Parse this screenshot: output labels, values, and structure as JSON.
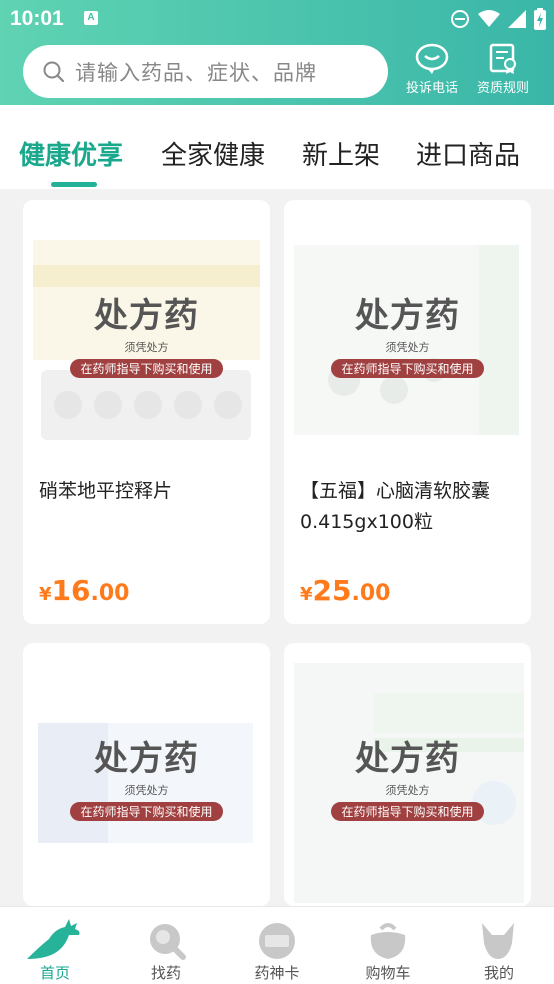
{
  "status_bar": {
    "time": "10:01",
    "badge": "A"
  },
  "search": {
    "placeholder": "请输入药品、症状、品牌"
  },
  "header_actions": [
    {
      "label": "投诉电话",
      "icon": "chat-bubble-icon"
    },
    {
      "label": "资质规则",
      "icon": "certificate-icon"
    }
  ],
  "tabs": [
    {
      "label": "健康优享",
      "active": true
    },
    {
      "label": "全家健康",
      "active": false
    },
    {
      "label": "新上架",
      "active": false
    },
    {
      "label": "进口商品",
      "active": false
    }
  ],
  "products": [
    {
      "name": "硝苯地平控释片",
      "price_currency": "¥",
      "price_int": "16",
      "price_dec": ".00",
      "rx_title": "处方药",
      "rx_sub": "须凭处方",
      "rx_pill": "在药师指导下购买和使用"
    },
    {
      "name": "【五福】心脑清软胶囊0.415gx100粒",
      "price_currency": "¥",
      "price_int": "25",
      "price_dec": ".00",
      "rx_title": "处方药",
      "rx_sub": "须凭处方",
      "rx_pill": "在药师指导下购买和使用"
    },
    {
      "name": "",
      "rx_title": "处方药",
      "rx_sub": "须凭处方",
      "rx_pill": "在药师指导下购买和使用"
    },
    {
      "name": "",
      "rx_title": "处方药",
      "rx_sub": "须凭处方",
      "rx_pill": "在药师指导下购买和使用"
    }
  ],
  "bottom_nav": [
    {
      "label": "首页",
      "icon": "kangaroo-icon",
      "active": true
    },
    {
      "label": "找药",
      "icon": "magnifier-icon",
      "active": false
    },
    {
      "label": "药神卡",
      "icon": "card-icon",
      "active": false
    },
    {
      "label": "购物车",
      "icon": "cart-icon",
      "active": false
    },
    {
      "label": "我的",
      "icon": "profile-icon",
      "active": false
    }
  ],
  "colors": {
    "accent": "#1aa88c",
    "header": "#49c2ad",
    "price": "#ff7a1a",
    "rx_pill": "#a04040"
  }
}
